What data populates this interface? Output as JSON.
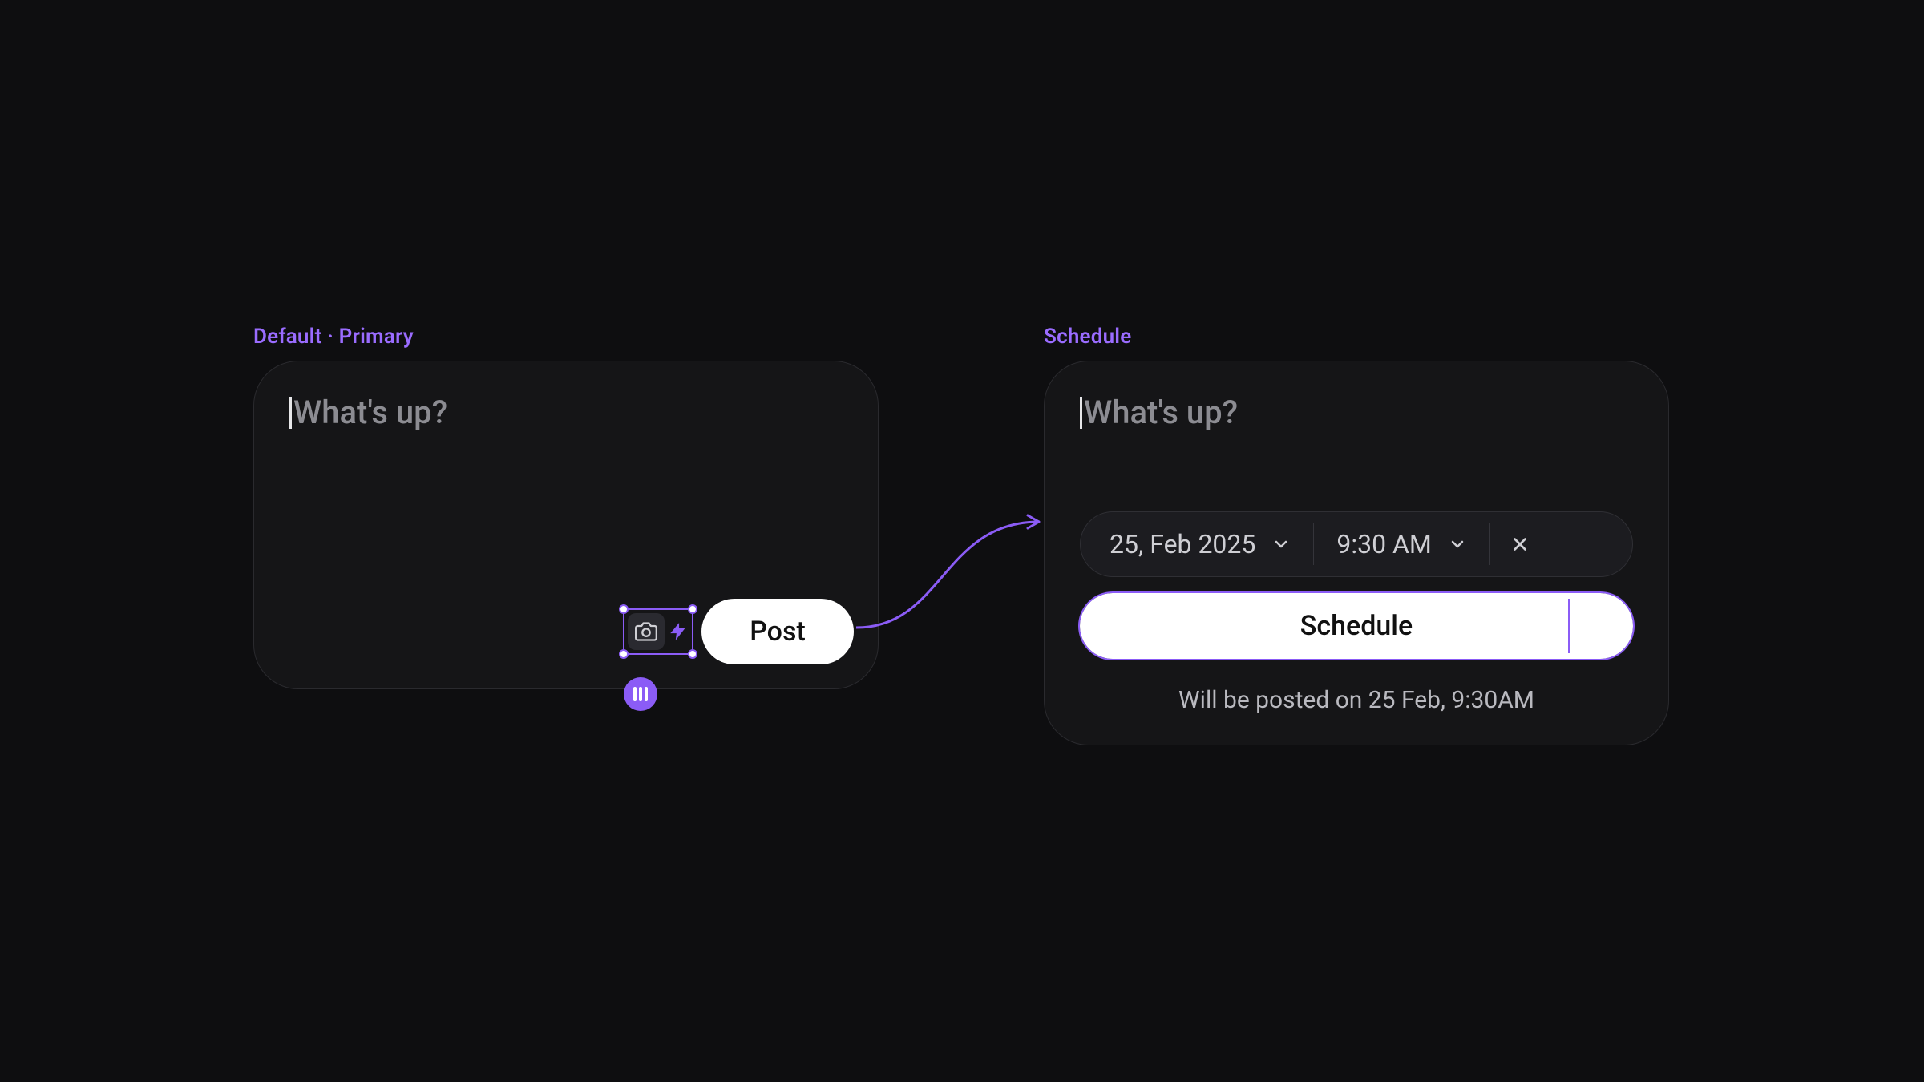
{
  "labels": {
    "left_frame": "Default · Primary",
    "right_frame": "Schedule"
  },
  "composer": {
    "placeholder": "What's up?",
    "post_button": "Post"
  },
  "schedule": {
    "placeholder": "What's up?",
    "date_value": "25, Feb 2025",
    "time_value": "9:30 AM",
    "schedule_button": "Schedule",
    "note": "Will be posted on 25 Feb, 9:30AM"
  },
  "icons": {
    "camera": "camera-icon",
    "lightning": "lightning-icon",
    "chevron_down": "chevron-down-icon",
    "close": "close-icon",
    "variants_badge": "variants-badge-icon"
  },
  "colors": {
    "accent": "#8b5cf6",
    "bg": "#0e0e10",
    "card": "#151517",
    "text_muted": "#8c8c92"
  }
}
